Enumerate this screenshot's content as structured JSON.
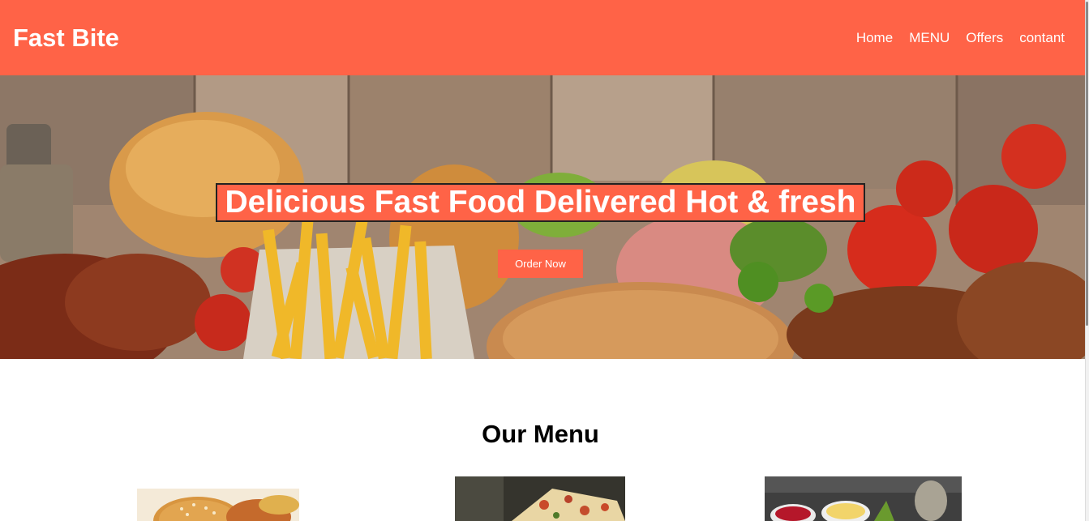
{
  "header": {
    "logo": "Fast Bite",
    "nav": [
      {
        "label": "Home"
      },
      {
        "label": "MENU"
      },
      {
        "label": "Offers"
      },
      {
        "label": "contant"
      }
    ]
  },
  "hero": {
    "title": "Delicious Fast Food Delivered Hot & fresh",
    "cta_label": "Order Now"
  },
  "menu": {
    "title": "Our Menu",
    "items": [
      {
        "image": "burger"
      },
      {
        "image": "pizza"
      },
      {
        "image": "sauces"
      }
    ]
  },
  "colors": {
    "brand": "#ff6347",
    "text_light": "#ffffff",
    "text_dark": "#000000"
  }
}
